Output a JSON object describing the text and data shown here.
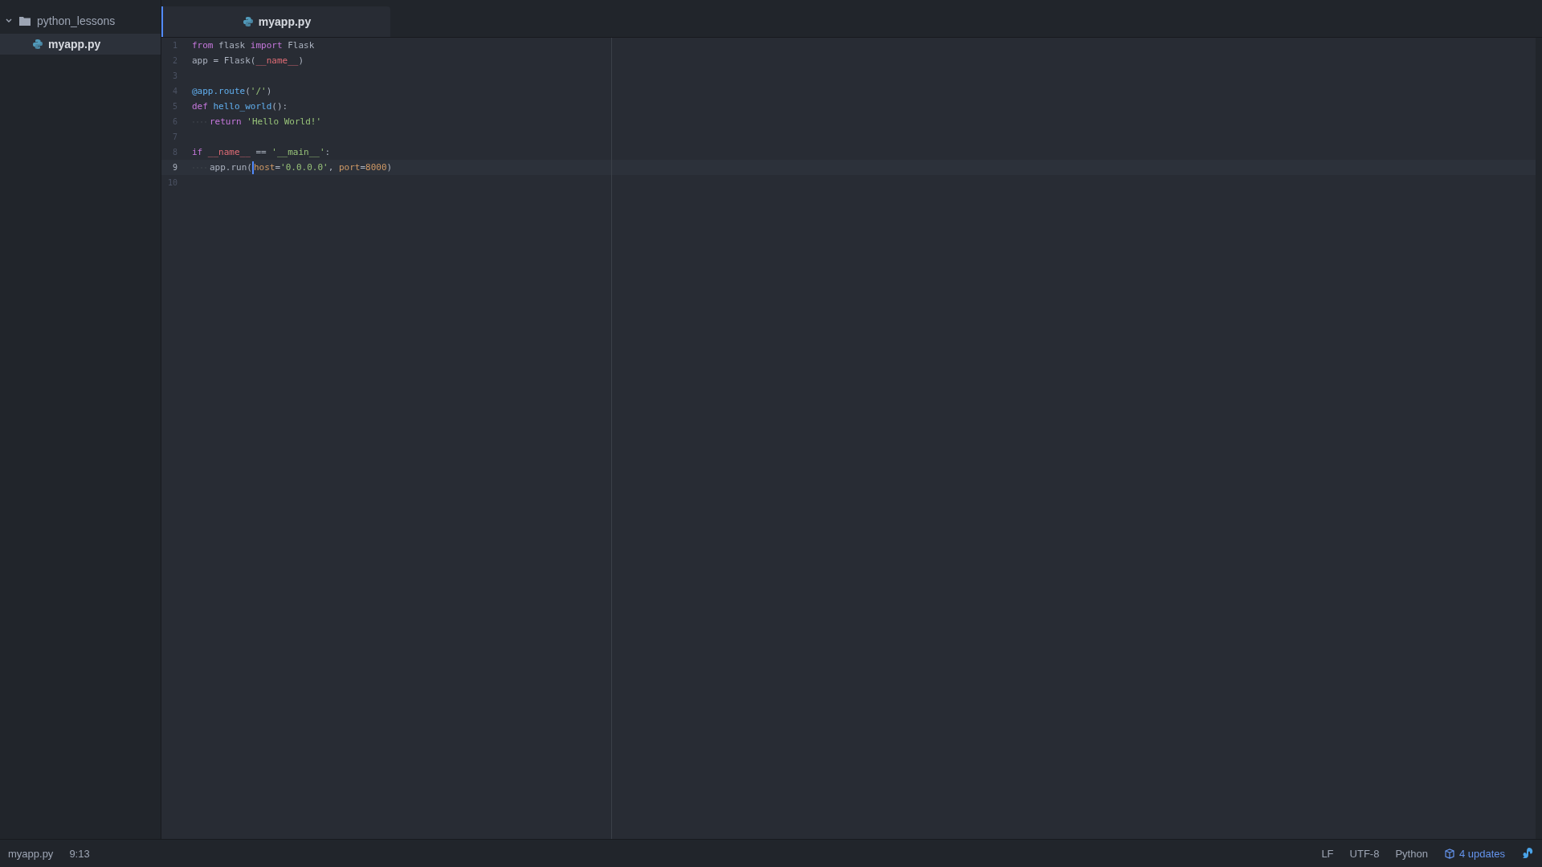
{
  "sidebar": {
    "folder": {
      "label": "python_lessons",
      "expanded": true,
      "children": [
        {
          "label": "myapp.py",
          "selected": true
        }
      ]
    }
  },
  "tabs": [
    {
      "label": "myapp.py",
      "selected": true
    }
  ],
  "editor": {
    "lines": [
      {
        "number": "1",
        "current": false,
        "indented": false,
        "tokens": [
          {
            "kind": "keyword",
            "text": "from"
          },
          {
            "kind": "plain",
            "text": " flask "
          },
          {
            "kind": "keyword",
            "text": "import"
          },
          {
            "kind": "plain",
            "text": " Flask"
          }
        ]
      },
      {
        "number": "2",
        "current": false,
        "indented": false,
        "tokens": [
          {
            "kind": "plain",
            "text": "app = Flask("
          },
          {
            "kind": "variable",
            "text": "__name__"
          },
          {
            "kind": "plain",
            "text": ")"
          }
        ]
      },
      {
        "number": "3",
        "current": false,
        "indented": false
      },
      {
        "number": "4",
        "current": false,
        "indented": false,
        "tokens": [
          {
            "kind": "function",
            "text": "@app.route"
          },
          {
            "kind": "plain",
            "text": "("
          },
          {
            "kind": "string",
            "text": "'/'"
          },
          {
            "kind": "plain",
            "text": ")"
          }
        ]
      },
      {
        "number": "5",
        "current": false,
        "indented": false,
        "tokens": [
          {
            "kind": "keyword",
            "text": "def"
          },
          {
            "kind": "function",
            "text": " hello_world"
          },
          {
            "kind": "plain",
            "text": "():"
          }
        ]
      },
      {
        "number": "6",
        "current": false,
        "indented": true,
        "tokens": [
          {
            "kind": "keyword",
            "text": "return"
          },
          {
            "kind": "string",
            "text": " 'Hello World!'"
          }
        ]
      },
      {
        "number": "7",
        "current": false,
        "indented": false
      },
      {
        "number": "8",
        "current": false,
        "indented": false,
        "tokens": [
          {
            "kind": "keyword",
            "text": "if"
          },
          {
            "kind": "variable",
            "text": " __name__"
          },
          {
            "kind": "plain",
            "text": " == "
          },
          {
            "kind": "string",
            "text": "'__main__'"
          },
          {
            "kind": "plain",
            "text": ":"
          }
        ]
      },
      {
        "number": "9",
        "current": true,
        "indented": true,
        "tokens": [
          {
            "kind": "plain",
            "text": "app.run("
          },
          {
            "kind": "cursor"
          },
          {
            "kind": "parameter",
            "text": "host"
          },
          {
            "kind": "plain",
            "text": "="
          },
          {
            "kind": "string",
            "text": "'0.0.0.0'"
          },
          {
            "kind": "plain",
            "text": ", "
          },
          {
            "kind": "parameter",
            "text": "port"
          },
          {
            "kind": "plain",
            "text": "="
          },
          {
            "kind": "parameter",
            "text": "8000"
          },
          {
            "kind": "plain",
            "text": ")"
          }
        ]
      },
      {
        "number": "10",
        "current": false,
        "indented": false
      }
    ]
  },
  "status_bar": {
    "left": [
      {
        "text": "myapp.py"
      },
      {
        "text": "9:13"
      }
    ],
    "right": [
      {
        "text": "LF"
      },
      {
        "text": "UTF-8"
      },
      {
        "text": "Python"
      }
    ],
    "updates": "4 updates"
  }
}
